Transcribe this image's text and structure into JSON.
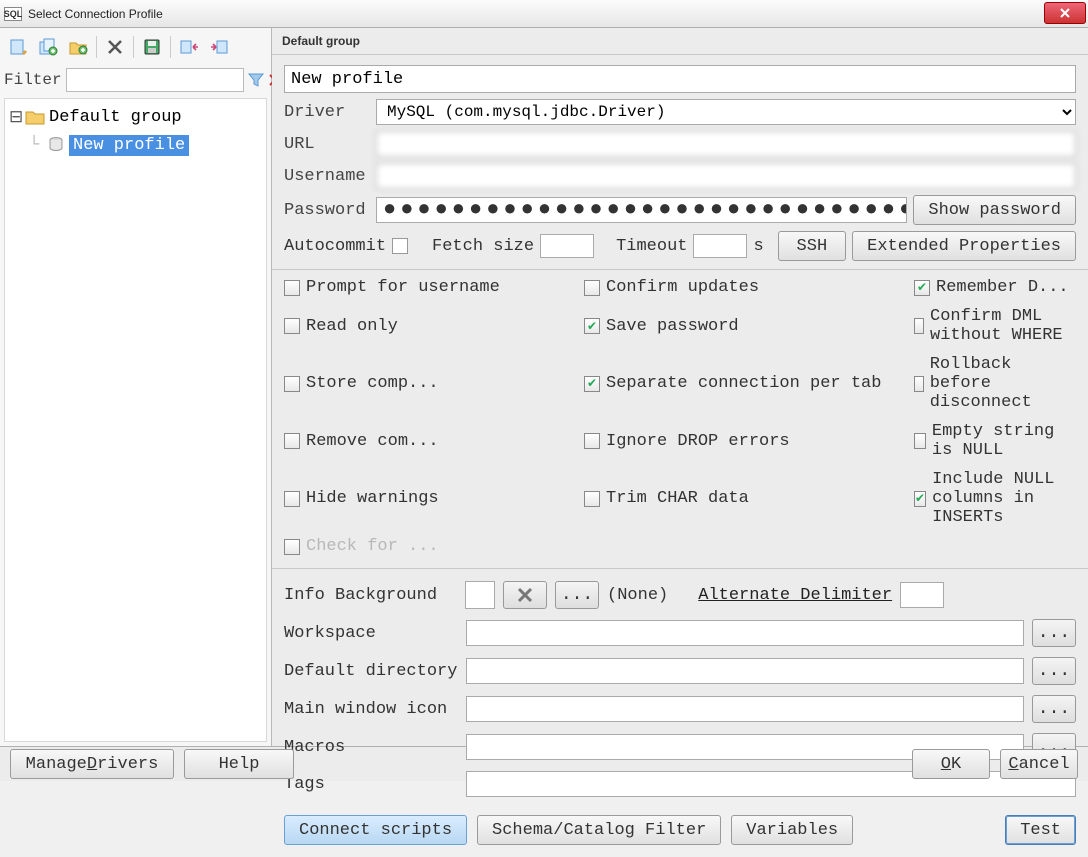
{
  "title": "Select Connection Profile",
  "left": {
    "filter_label": "Filter",
    "tree": {
      "group": "Default group",
      "profile": "New profile"
    }
  },
  "group_header": "Default group",
  "form": {
    "profile_name": "New profile",
    "driver_label": "Driver",
    "driver_value": "MySQL (com.mysql.jdbc.Driver)",
    "url_label": "URL",
    "url_value": "",
    "username_label": "Username",
    "username_value": "",
    "password_label": "Password",
    "password_masked": "●●●●●●●●●●●●●●●●●●●●●●●●●●●●●●●●",
    "show_password": "Show password",
    "autocommit": "Autocommit",
    "fetch_size": "Fetch size",
    "fetch_size_value": "",
    "timeout": "Timeout",
    "timeout_value": "",
    "timeout_unit": "s",
    "ssh": "SSH",
    "ext_props": "Extended Properties"
  },
  "checks": {
    "c1": "Prompt for username",
    "c2": "Confirm updates",
    "c3": "Read only",
    "c4": "Remember D...",
    "c5": "Save password",
    "c6": "Confirm DML without WHERE",
    "c7": "Store comp...",
    "c8": "Separate connection per tab",
    "c9": "Rollback before disconnect",
    "c10": "Remove com...",
    "c11": "Ignore DROP errors",
    "c12": "Empty string is NULL",
    "c13": "Hide warnings",
    "c14": "Trim CHAR data",
    "c15": "Include NULL columns in INSERTs",
    "c16": "Check for ..."
  },
  "section2": {
    "info_bg": "Info Background",
    "none": "(None)",
    "alt_delim": "Alternate Delimiter",
    "alt_delim_value": "",
    "workspace": "Workspace",
    "default_dir": "Default directory",
    "main_icon": "Main window icon",
    "macros": "Macros",
    "tags": "Tags",
    "browse": "..."
  },
  "bottom": {
    "connect_scripts": "Connect scripts",
    "schema_filter": "Schema/Catalog Filter",
    "variables": "Variables",
    "test": "Test"
  },
  "footer": {
    "manage_drivers_pre": "Manage ",
    "manage_drivers_u": "D",
    "manage_drivers_post": "rivers",
    "help": "Help",
    "ok_u": "O",
    "ok_post": "K",
    "cancel_u": "C",
    "cancel_post": "ancel"
  }
}
